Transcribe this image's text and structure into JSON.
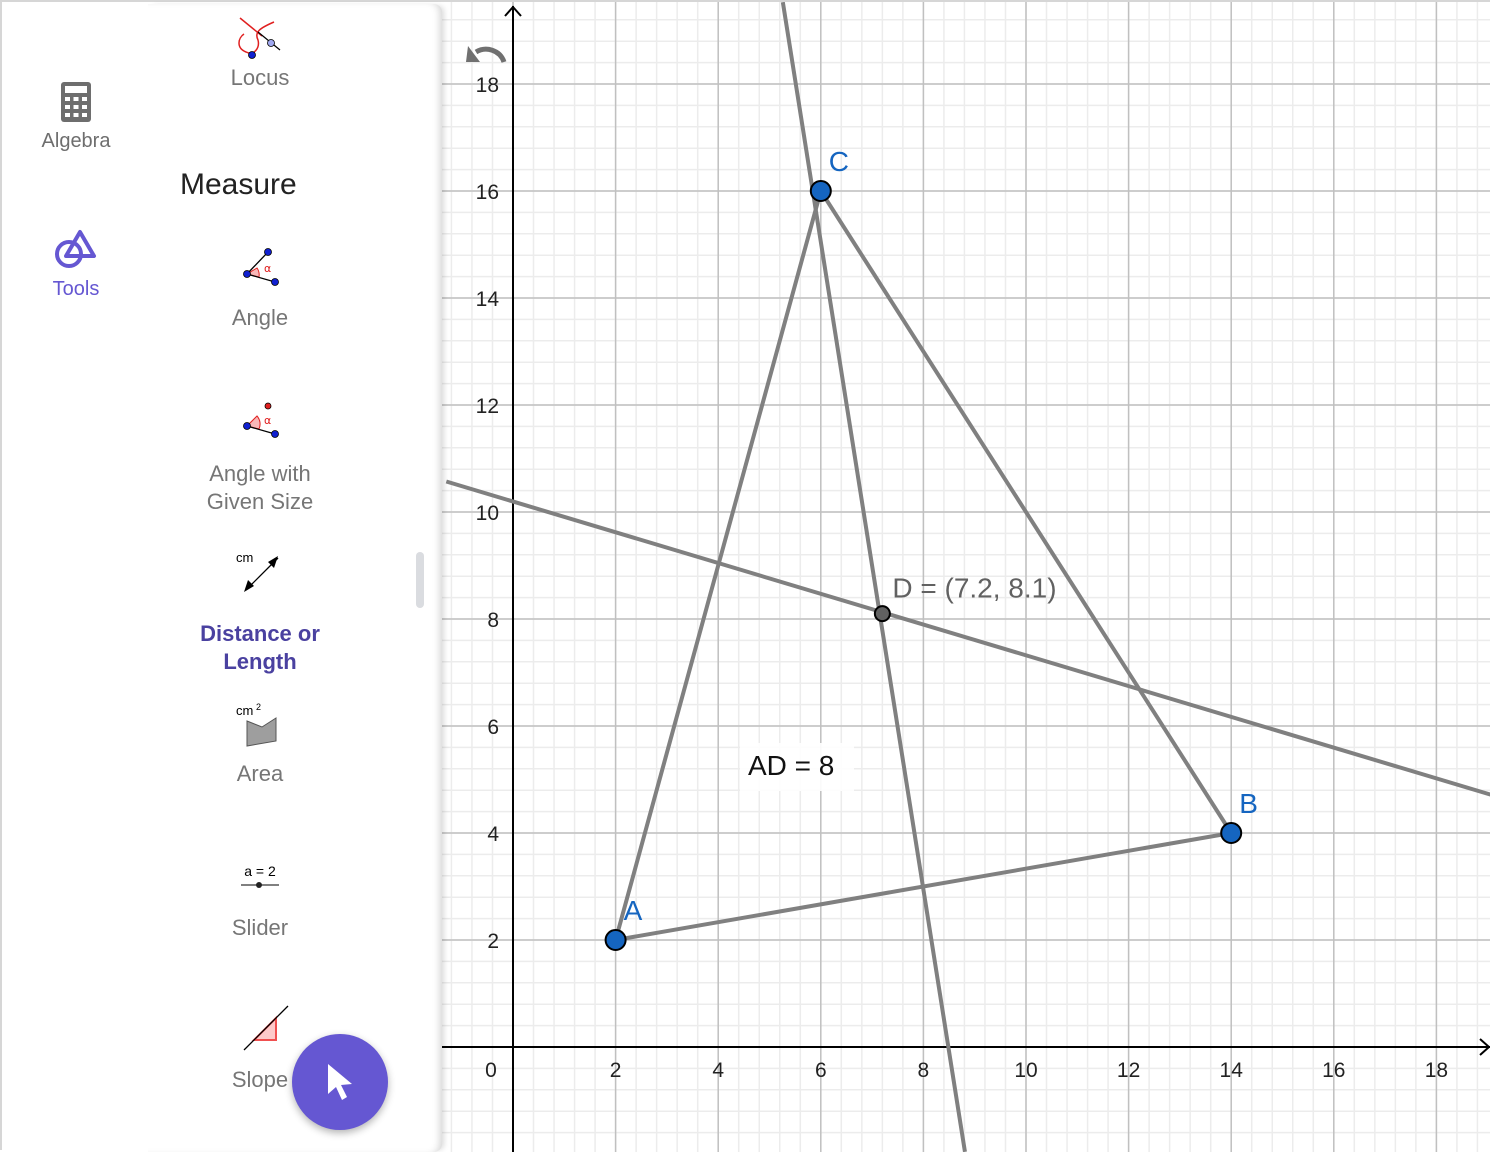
{
  "rail": {
    "items": [
      {
        "label": "Algebra",
        "icon": "calculator-icon",
        "active": false
      },
      {
        "label": "Tools",
        "icon": "tools-shapes-icon",
        "active": true
      }
    ]
  },
  "toolpanel": {
    "top_tool": {
      "label": "Locus",
      "icon": "locus-icon"
    },
    "section_title": "Measure",
    "tools": [
      {
        "label": "Angle",
        "icon": "angle-icon"
      },
      {
        "label_line1": "Angle with",
        "label_line2": "Given Size",
        "icon": "angle-given-size-icon"
      },
      {
        "label_line1": "Distance or",
        "label_line2": "Length",
        "icon": "distance-icon",
        "selected": true,
        "icon_text": "cm"
      },
      {
        "label": "Area",
        "icon": "area-icon",
        "icon_text": "cm",
        "icon_sup": "2"
      },
      {
        "label": "Slider",
        "icon": "slider-icon",
        "icon_text": "a = 2"
      },
      {
        "label": "Slope",
        "icon": "slope-icon"
      }
    ]
  },
  "fab": {
    "icon": "move-cursor-icon"
  },
  "graphics": {
    "undo_icon": "undo-icon",
    "x_ticks": [
      "0",
      "2",
      "4",
      "6",
      "8",
      "10",
      "12",
      "14",
      "16",
      "18"
    ],
    "y_ticks": [
      "2",
      "4",
      "6",
      "8",
      "10",
      "12",
      "14",
      "16",
      "18"
    ],
    "view": {
      "xmin": -1.3,
      "xmax": 19.08,
      "ymin": -1.96,
      "ymax": 19.53
    },
    "points": [
      {
        "name": "A",
        "x": 2,
        "y": 2,
        "label": "A",
        "color": "#1565c0"
      },
      {
        "name": "B",
        "x": 14,
        "y": 4,
        "label": "B",
        "color": "#1565c0"
      },
      {
        "name": "C",
        "x": 6,
        "y": 16,
        "label": "C",
        "color": "#1565c0"
      },
      {
        "name": "D",
        "x": 7.2,
        "y": 8.1,
        "label": "D = (7.2, 8.1)",
        "color": "#616161"
      }
    ],
    "segments": [
      {
        "from": "A",
        "to": "B"
      },
      {
        "from": "A",
        "to": "C"
      },
      {
        "from": "C",
        "to": "B"
      }
    ],
    "lines": [
      {
        "name": "steep-line",
        "p1": [
          5.26,
          19.53
        ],
        "p2": [
          8.81,
          -1.96
        ]
      },
      {
        "name": "shallow-line",
        "p1": [
          -1.3,
          10.57
        ],
        "p2": [
          19.08,
          4.71
        ]
      }
    ],
    "measure_text": "AD = 8",
    "colors": {
      "line": "#808080",
      "point_blue": "#1565c0",
      "point_gray": "#616161",
      "accent": "#6557d2"
    }
  }
}
